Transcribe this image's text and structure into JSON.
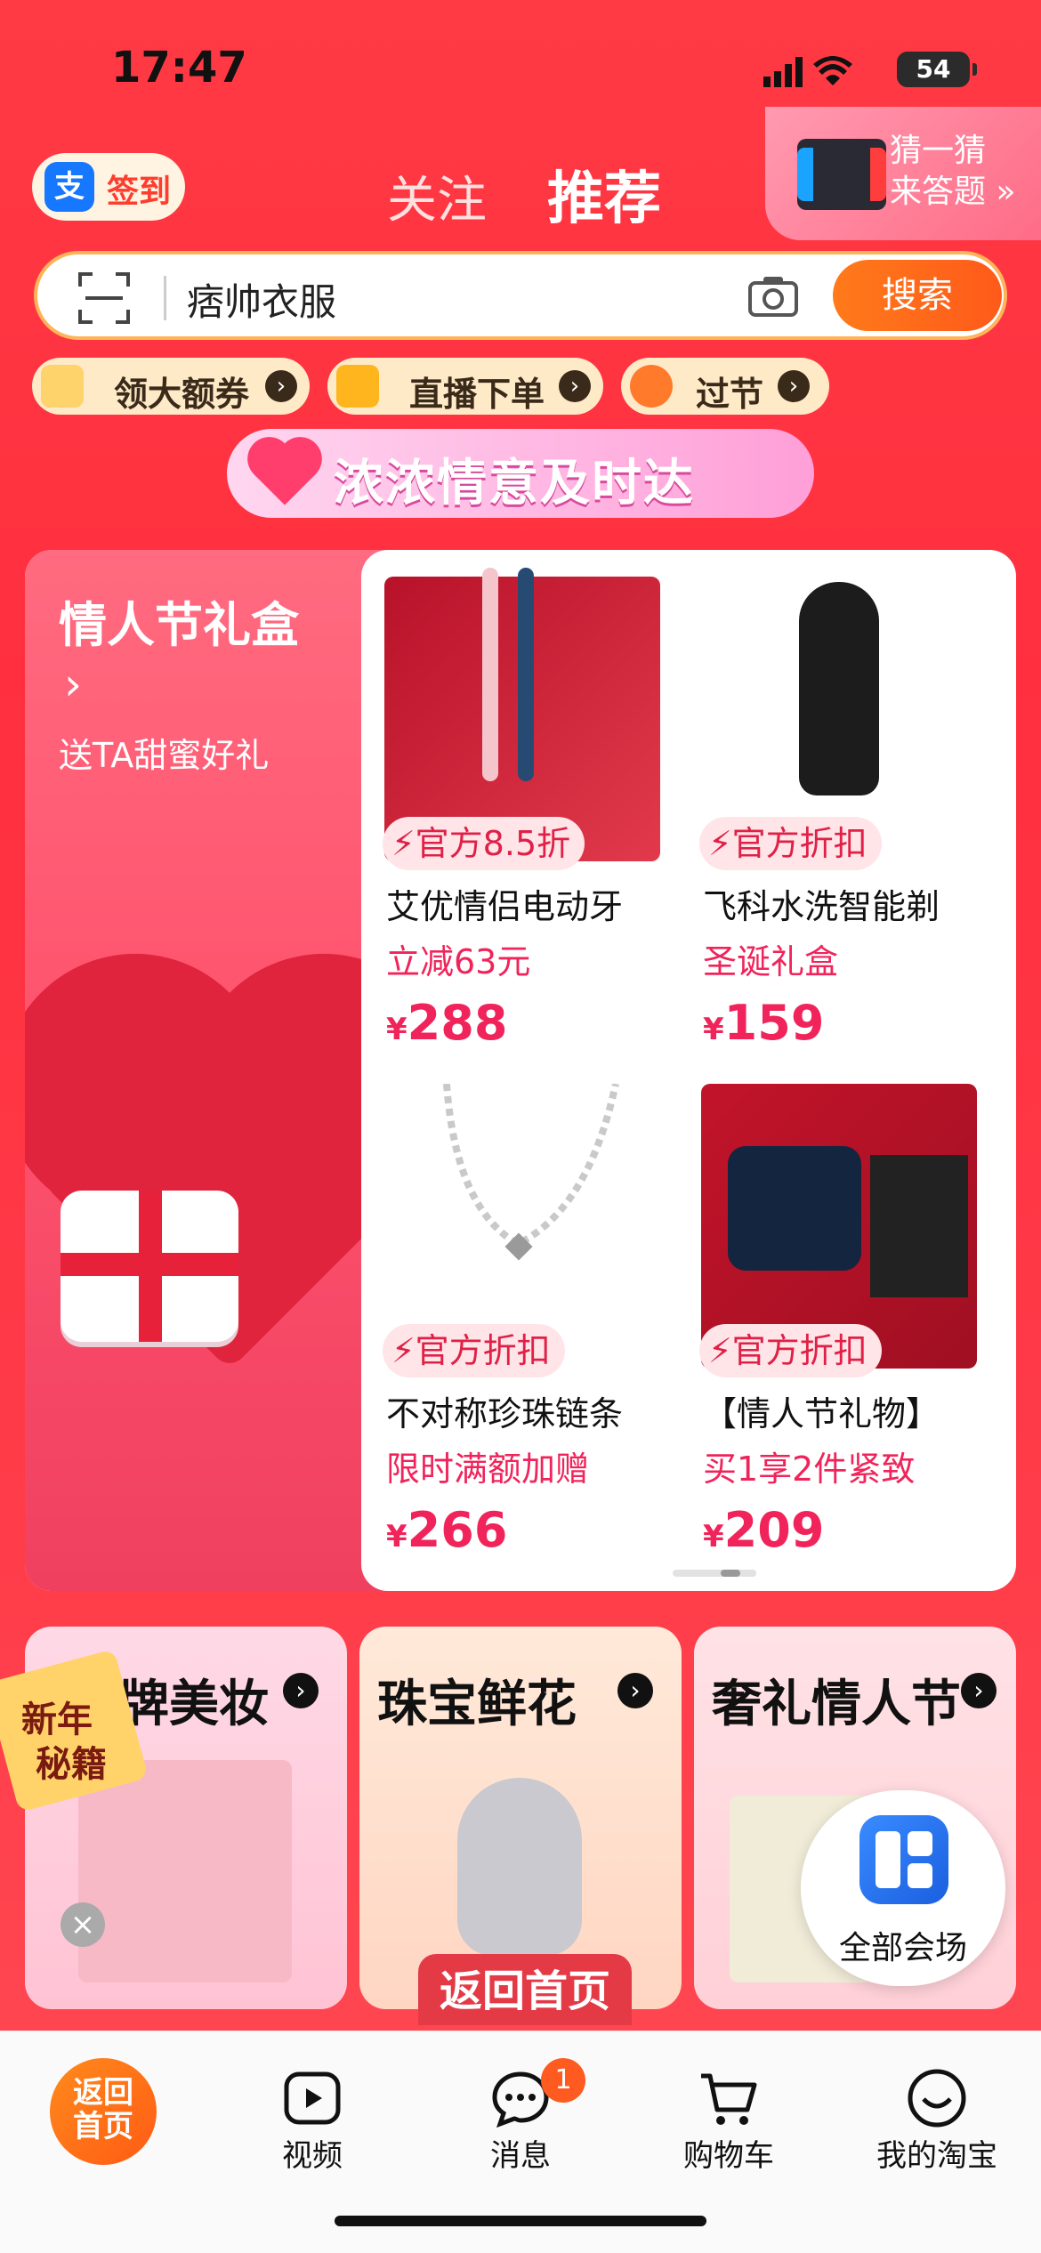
{
  "status": {
    "time": "17:47",
    "battery": "54"
  },
  "header": {
    "signin_label": "签到",
    "signin_icon": "支",
    "tabs": [
      {
        "label": "关注"
      },
      {
        "label": "推荐"
      }
    ],
    "guess": {
      "line1": "猜一猜",
      "line2": "来答题 »"
    }
  },
  "search": {
    "query": "痞帅衣服",
    "button": "搜索"
  },
  "pills": [
    {
      "label": "领大额券"
    },
    {
      "label": "直播下单"
    },
    {
      "label": "过节"
    }
  ],
  "banner": {
    "title": "浓浓情意及时达"
  },
  "gift": {
    "title": "情人节礼盒",
    "arrow": "›",
    "subtitle": "送TA甜蜜好礼",
    "products": [
      {
        "badge": "⚡官方8.5折",
        "name": "艾优情侣电动牙",
        "sub": "立减63元",
        "currency": "¥",
        "price": "288"
      },
      {
        "badge": "⚡官方折扣",
        "name": "飞科水洗智能剃",
        "sub": "圣诞礼盒",
        "currency": "¥",
        "price": "159"
      },
      {
        "badge": "⚡官方折扣",
        "name": "不对称珍珠链条",
        "sub": "限时满额加赠",
        "currency": "¥",
        "price": "266"
      },
      {
        "badge": "⚡官方折扣",
        "name": "【情人节礼物】",
        "sub": "买1享2件紧致",
        "currency": "¥",
        "price": "209"
      }
    ]
  },
  "categories": [
    {
      "title": "大牌美妆",
      "arrow": "›"
    },
    {
      "title": "珠宝鲜花",
      "arrow": "›"
    },
    {
      "title": "奢礼情人节",
      "arrow": "›"
    }
  ],
  "newyear": {
    "line1": "新年",
    "line2": "秘籍"
  },
  "close_label": "×",
  "back_home": "返回首页",
  "all_venue": "全部会场",
  "tabbar": {
    "home": {
      "line1": "返回",
      "line2": "首页"
    },
    "video": "视频",
    "messages": "消息",
    "messages_count": "1",
    "cart": "购物车",
    "me": "我的淘宝"
  },
  "colors": {
    "brand_red": "#ff3a44",
    "accent_orange": "#ff6a1a",
    "price_pink": "#f0245a"
  }
}
